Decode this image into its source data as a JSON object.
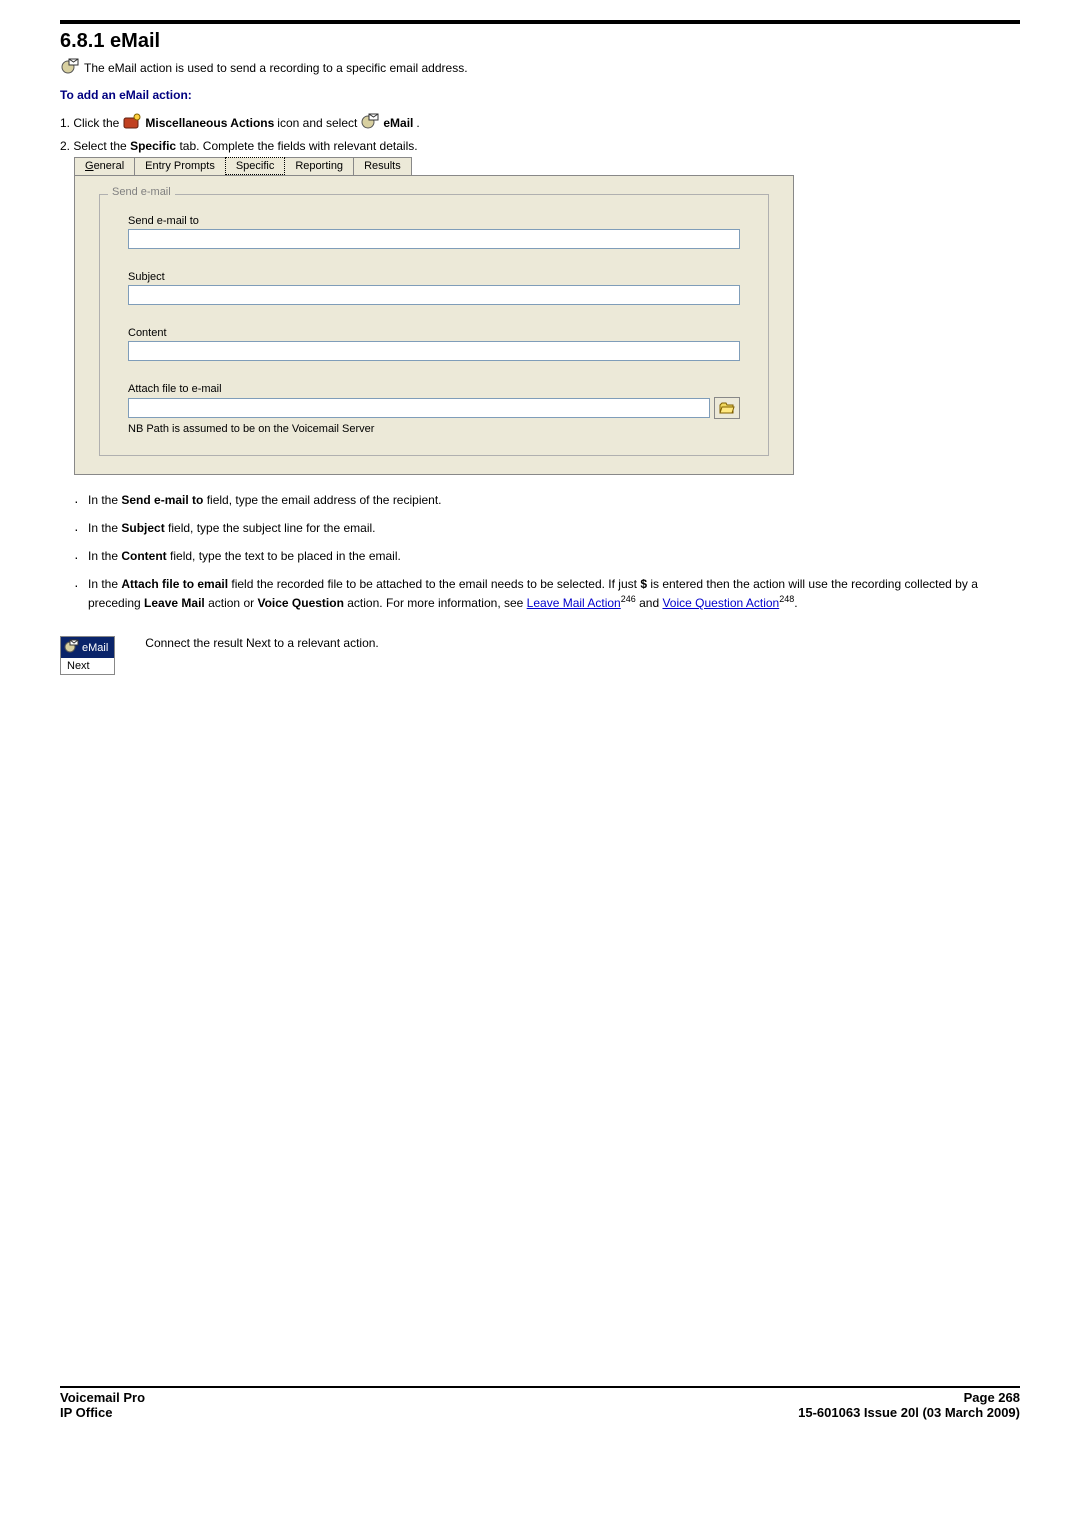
{
  "heading": "6.8.1 eMail",
  "intro": "The eMail action is used to send a recording to a specific email address.",
  "subhead": "To add an eMail action:",
  "step1_prefix": "1. Click the",
  "step1_bold1": "Miscellaneous Actions",
  "step1_mid": "icon and select",
  "step1_bold2": "eMail",
  "step1_suffix": ".",
  "step2_prefix": "2. Select the",
  "step2_bold": "Specific",
  "step2_suffix": "tab. Complete the fields with relevant details.",
  "tabs": {
    "general": "General",
    "general_u": "G",
    "general_rest": "eneral",
    "entry": "Entry Prompts",
    "specific": "Specific",
    "reporting": "Reporting",
    "results": "Results"
  },
  "group_legend": "Send e-mail",
  "labels": {
    "sendto": "Send e-mail to",
    "subject": "Subject",
    "content": "Content",
    "attach": "Attach file to e-mail"
  },
  "nb": "NB Path is assumed to be on the Voicemail Server",
  "bullets": {
    "b1_pre": "In the ",
    "b1_bold": "Send e-mail to",
    "b1_post": " field, type the email address of the recipient.",
    "b2_pre": "In the ",
    "b2_bold": "Subject",
    "b2_post": " field, type the subject line for the email.",
    "b3_pre": "In the ",
    "b3_bold": "Content",
    "b3_post": " field, type the text to be placed in the email.",
    "b4_pre": "In the ",
    "b4_bold": "Attach file to email",
    "b4_mid1": " field the recorded file to be attached to the email needs to be selected. If just ",
    "b4_bold2": "$",
    "b4_mid2": " is entered then the action will use the recording collected by a preceding ",
    "b4_bold3": "Leave Mail",
    "b4_mid3": " action or ",
    "b4_bold4": "Voice Question",
    "b4_mid4": " action. For more information, see ",
    "b4_link1": "Leave Mail Action",
    "b4_ref1": "246",
    "b4_and": " and ",
    "b4_link2": "Voice Question Action",
    "b4_ref2": "248",
    "b4_end": "."
  },
  "result_text": "Connect the result Next to a relevant action.",
  "widget": {
    "top": "eMail",
    "bottom": "Next"
  },
  "footer": {
    "left1": "Voicemail Pro",
    "right1": "Page 268",
    "left2": "IP Office",
    "right2": "15-601063 Issue 20l (03 March 2009)"
  }
}
